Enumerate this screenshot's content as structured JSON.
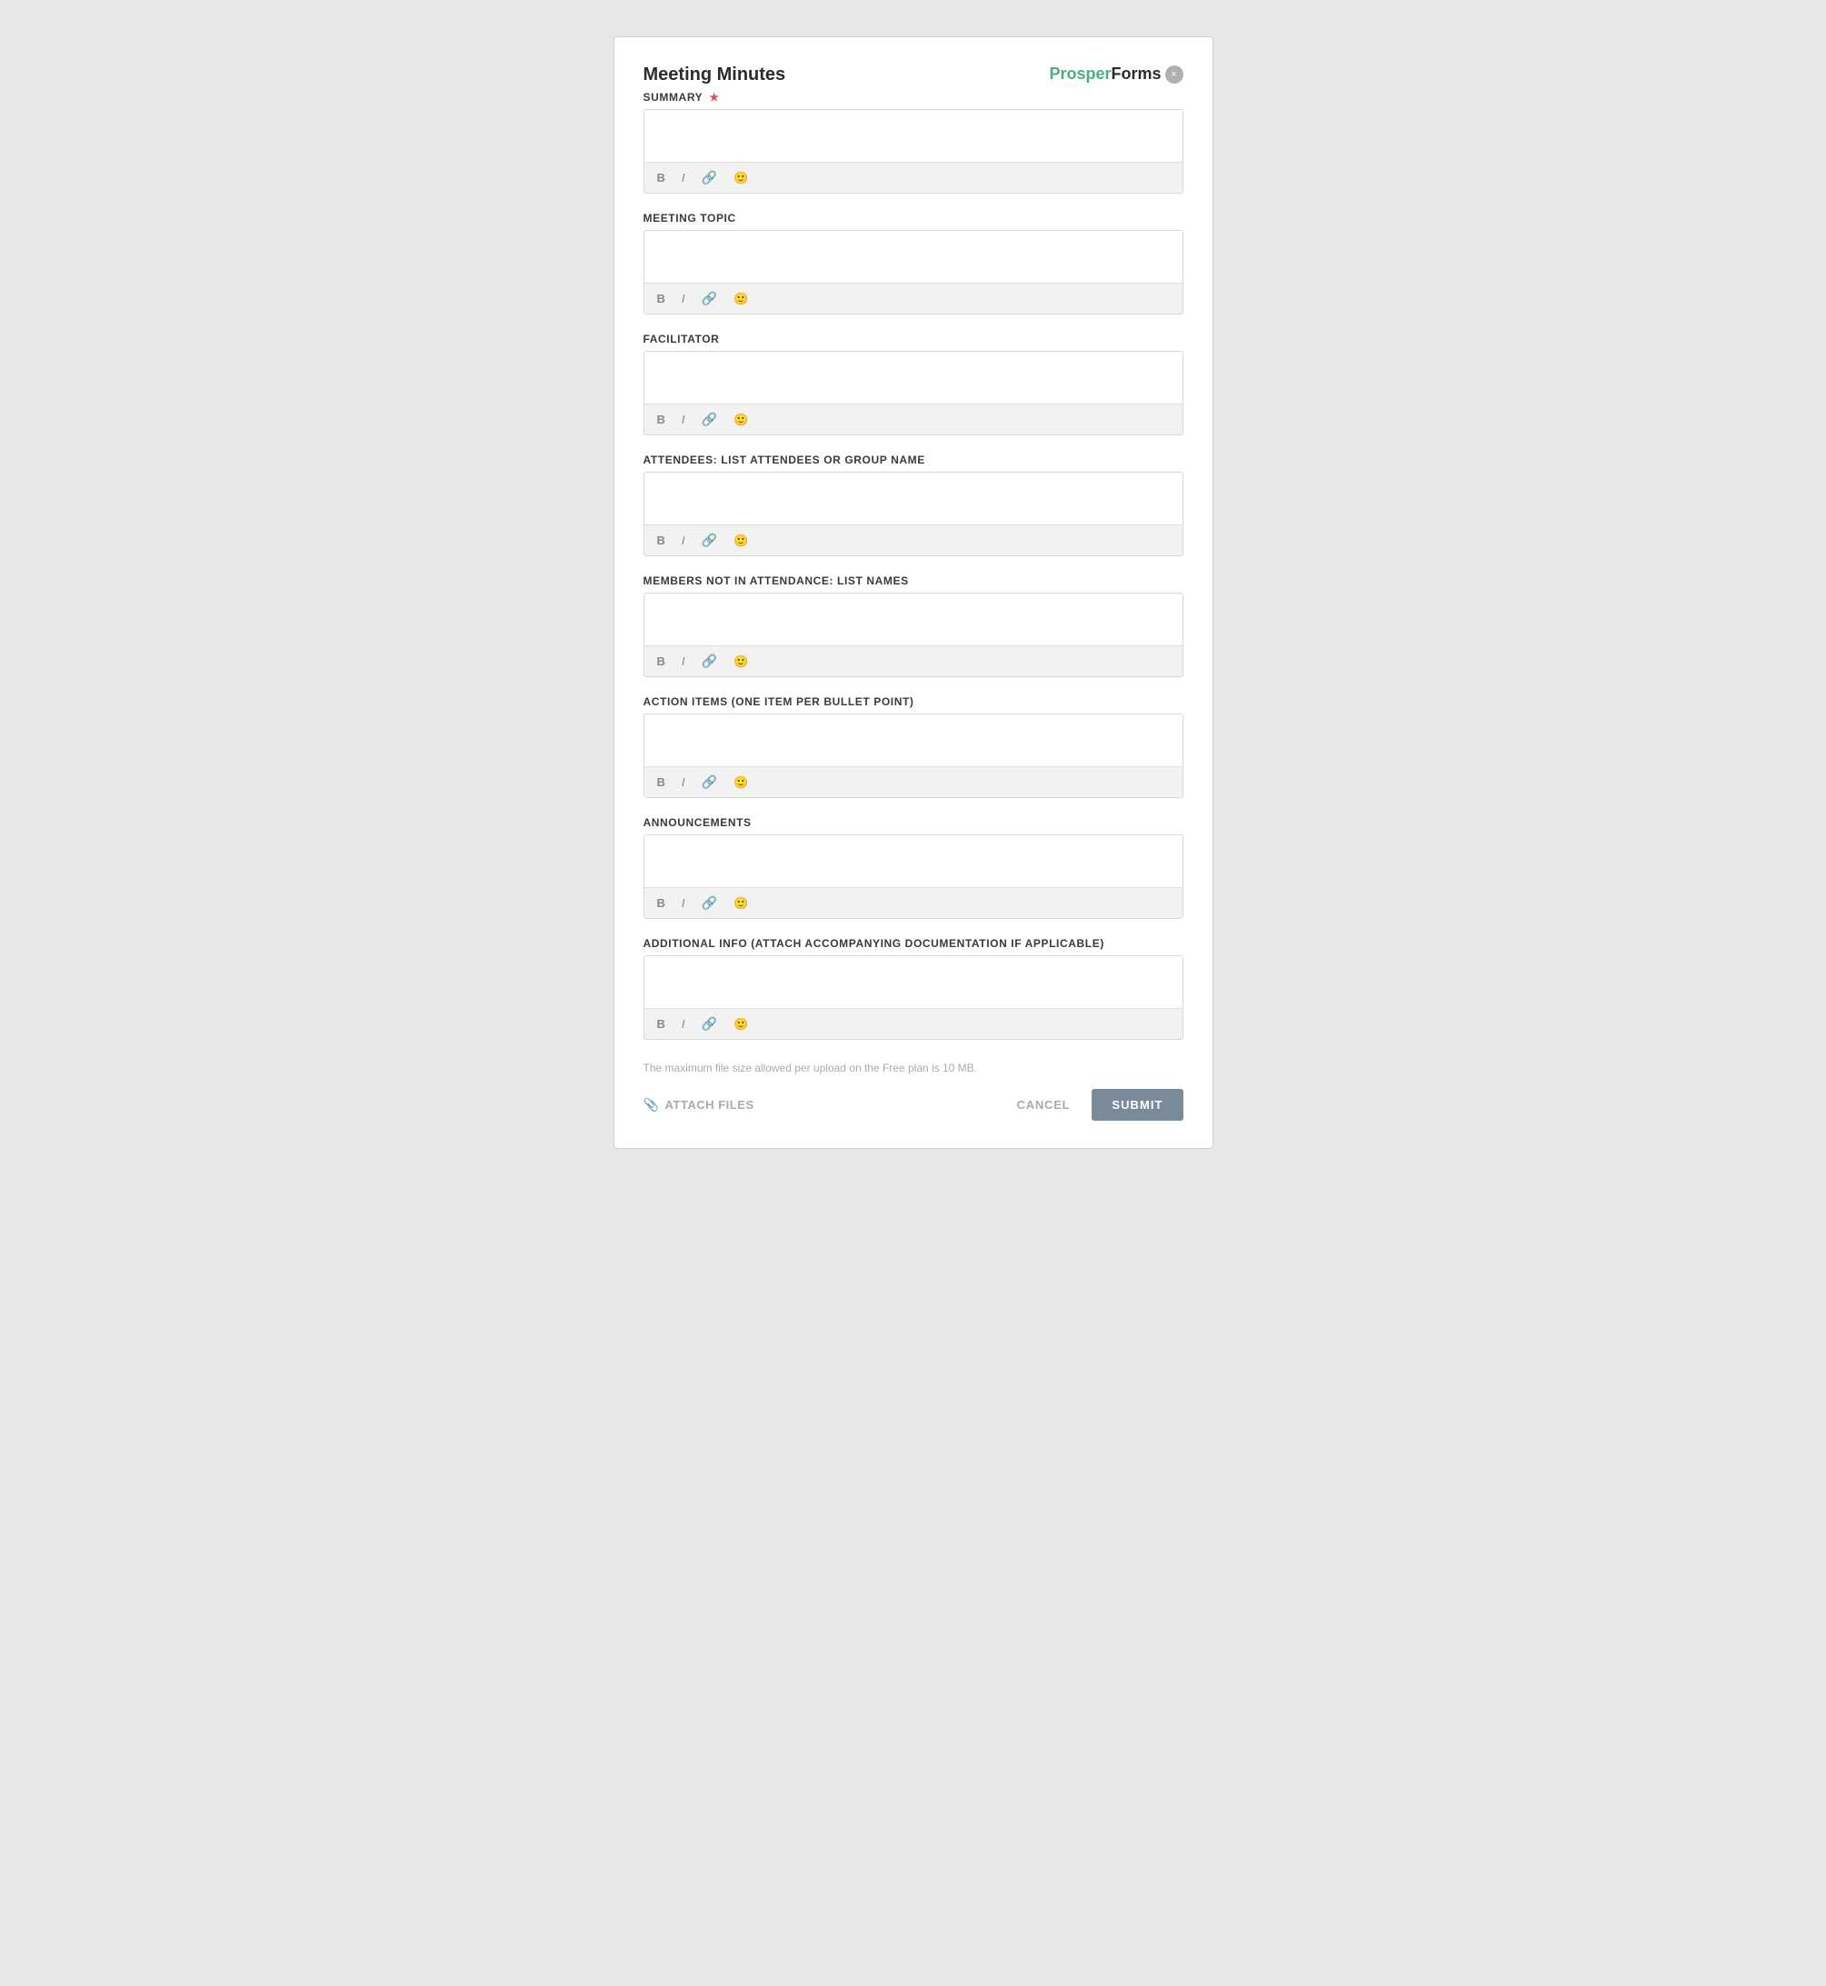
{
  "header": {
    "title": "Meeting Minutes",
    "brand_prosper": "Prosper",
    "brand_forms": "Forms",
    "close_label": "×"
  },
  "fields": [
    {
      "id": "summary",
      "label": "SUMMARY",
      "required": true,
      "placeholder": ""
    },
    {
      "id": "meeting_topic",
      "label": "MEETING TOPIC",
      "required": false,
      "placeholder": ""
    },
    {
      "id": "facilitator",
      "label": "FACILITATOR",
      "required": false,
      "placeholder": ""
    },
    {
      "id": "attendees",
      "label": "ATTENDEES: LIST ATTENDEES OR GROUP NAME",
      "required": false,
      "placeholder": ""
    },
    {
      "id": "members_not_attendance",
      "label": "MEMBERS NOT IN ATTENDANCE: LIST NAMES",
      "required": false,
      "placeholder": ""
    },
    {
      "id": "action_items",
      "label": "ACTION ITEMS (ONE ITEM PER BULLET POINT)",
      "required": false,
      "placeholder": ""
    },
    {
      "id": "announcements",
      "label": "ANNOUNCEMENTS",
      "required": false,
      "placeholder": ""
    },
    {
      "id": "additional_info",
      "label": "ADDITIONAL INFO (ATTACH ACCOMPANYING DOCUMENTATION IF APPLICABLE)",
      "required": false,
      "placeholder": ""
    }
  ],
  "toolbar": {
    "bold": "B",
    "italic": "I",
    "link": "🔗",
    "emoji": "🙂"
  },
  "footer": {
    "file_size_note": "The maximum file size allowed per upload on the Free plan is 10 MB.",
    "attach_label": "ATTACH FILES",
    "cancel_label": "CANCEL",
    "submit_label": "SUBMIT"
  }
}
